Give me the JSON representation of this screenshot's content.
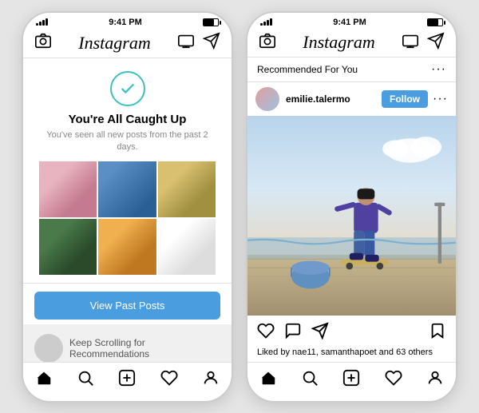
{
  "left_phone": {
    "status_bar": {
      "dots": "•••••",
      "time": "9:41 PM"
    },
    "nav": {
      "title": "Instagram"
    },
    "caught_up": {
      "title": "You're All Caught Up",
      "subtitle": "You've seen all new posts from the past 2 days."
    },
    "view_past_btn": "View Past Posts",
    "keep_scrolling": "Keep Scrolling for Recommendations",
    "tabs": [
      "home",
      "search",
      "add",
      "heart",
      "person"
    ]
  },
  "right_phone": {
    "status_bar": {
      "dots": "•••••",
      "time": "9:41 PM"
    },
    "nav": {
      "title": "Instagram"
    },
    "recommended_label": "Recommended For You",
    "post": {
      "username": "emilie.talermo",
      "follow_label": "Follow",
      "likes_text": "Liked by nae11, samanthapoet and 63 others"
    },
    "tabs": [
      "home",
      "search",
      "add",
      "heart",
      "person"
    ]
  }
}
